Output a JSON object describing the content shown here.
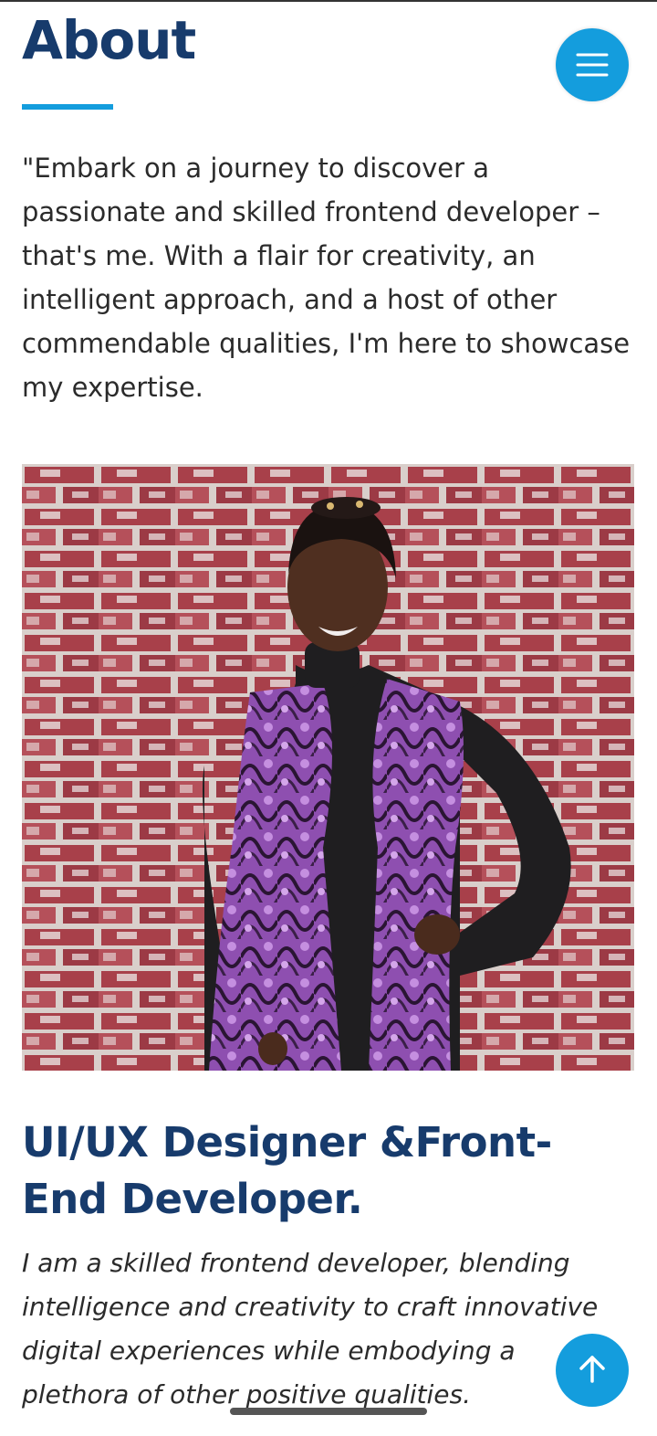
{
  "about": {
    "title": "About",
    "intro": "\"Embark on a journey to discover a passionate and skilled frontend developer – that's me. With a flair for creativity, an intelligent approach, and a host of other commendable qualities, I'm here to showcase my expertise."
  },
  "profile": {
    "photo_description": "Portrait photo"
  },
  "role": {
    "title": "UI/UX Designer &Front-End Developer.",
    "description": "I am a skilled frontend developer, blending intelligence and creativity to craft innovative digital experiences while embodying a plethora of other positive qualities."
  },
  "icons": {
    "menu": "hamburger-menu-icon",
    "back_to_top": "arrow-up-icon"
  },
  "colors": {
    "accent": "#149ddd",
    "heading": "#173b6c",
    "text": "#2b2b2b"
  }
}
